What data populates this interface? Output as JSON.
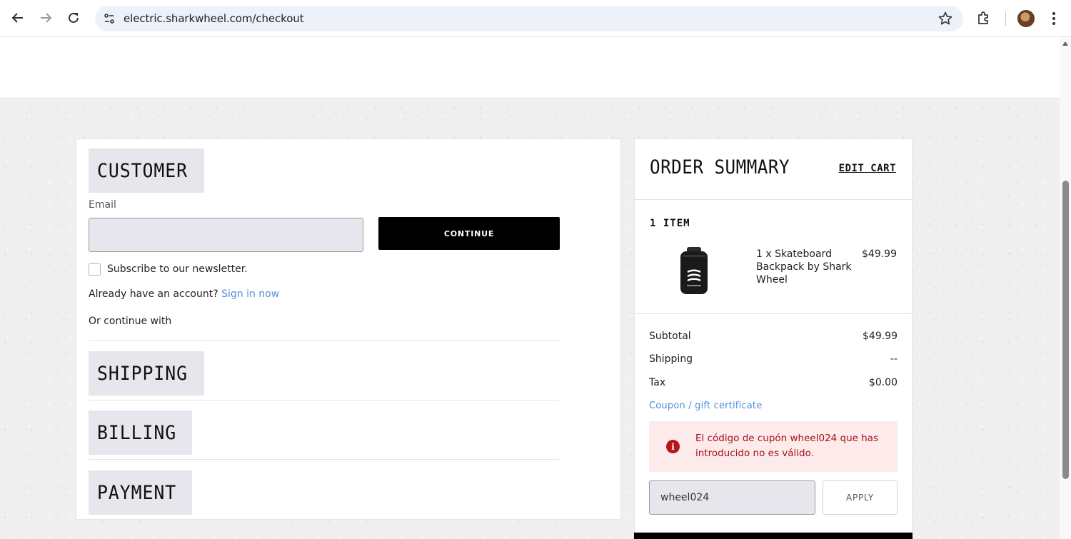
{
  "browser": {
    "url": "electric.sharkwheel.com/checkout",
    "icons": [
      "back-arrow-icon",
      "forward-arrow-icon",
      "reload-icon",
      "site-settings-icon",
      "bookmark-star-icon",
      "extensions-puzzle-icon",
      "profile-avatar",
      "more-menu-icon"
    ]
  },
  "checkout": {
    "customer_heading": "CUSTOMER",
    "email_label": "Email",
    "email_value": "",
    "continue_label": "CONTINUE",
    "newsletter_label": "Subscribe to our newsletter.",
    "newsletter_checked": false,
    "account_prompt": "Already have an account?",
    "signin_link": "Sign in now",
    "continue_with": "Or continue with",
    "shipping_heading": "SHIPPING",
    "billing_heading": "BILLING",
    "payment_heading": "PAYMENT"
  },
  "summary": {
    "title": "ORDER SUMMARY",
    "edit_cart": "EDIT CART",
    "items_count": "1 ITEM",
    "item": {
      "name": "1 x Skateboard Backpack by Shark Wheel",
      "price": "$49.99",
      "image_icon": "backpack-icon"
    },
    "subtotal_label": "Subtotal",
    "subtotal_value": "$49.99",
    "shipping_label": "Shipping",
    "shipping_value": "--",
    "tax_label": "Tax",
    "tax_value": "$0.00",
    "coupon_link": "Coupon / gift certificate",
    "error_message": "El código de cupón wheel024 que has introducido no es válido.",
    "coupon_value": "wheel024",
    "apply_label": "APPLY"
  },
  "colors": {
    "link": "#4f90d8",
    "error_text": "#a3121a",
    "error_bg": "#fdeaea",
    "button_dark": "#000000",
    "heading_bg": "#e6e6ec"
  }
}
